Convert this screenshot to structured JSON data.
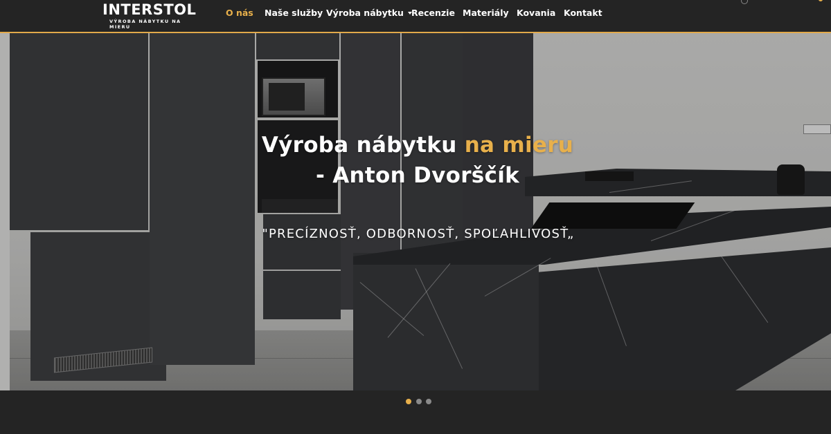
{
  "brand": {
    "name": "INTERSTOL",
    "tagline": "VÝROBA NÁBYTKU NA MIERU"
  },
  "nav": {
    "items": [
      {
        "label": "O nás",
        "active": true
      },
      {
        "label": "Naše služby",
        "active": false
      },
      {
        "label": "Výroba nábytku",
        "active": false,
        "has_dropdown": true
      },
      {
        "label": "Recenzie",
        "active": false
      },
      {
        "label": "Materiály",
        "active": false
      },
      {
        "label": "Kovania",
        "active": false
      },
      {
        "label": "Kontakt",
        "active": false
      }
    ]
  },
  "hero": {
    "title_part1": "Výroba nábytku ",
    "title_highlight": "na mieru",
    "title_line2": "- Anton Dvorščík",
    "subtitle": "\"PRECÍZNOSŤ, ODBORNOSŤ, SPOĽAHLIVOSŤ„"
  },
  "carousel": {
    "slide_count": 3,
    "active_index": 0
  },
  "colors": {
    "accent": "#e8b04b",
    "header_bg": "#242424",
    "text": "#ffffff"
  },
  "icons": {
    "corner_left": "search-icon",
    "corner_right": "cart-dot-icon"
  }
}
